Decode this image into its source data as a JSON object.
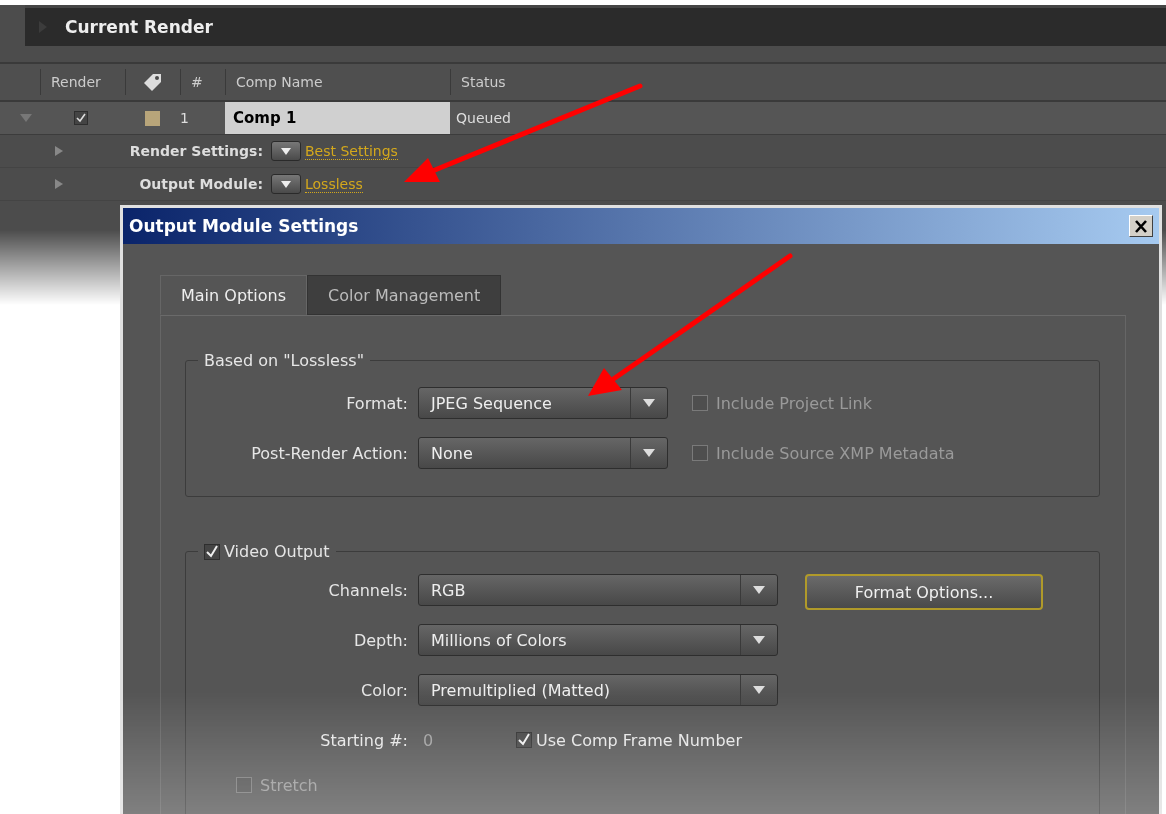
{
  "panel": {
    "title": "Current Render",
    "columns": [
      {
        "kind": "text",
        "label": "Render"
      },
      {
        "kind": "icon"
      },
      {
        "kind": "text",
        "label": "#"
      },
      {
        "kind": "text",
        "label": "Comp Name"
      },
      {
        "kind": "text",
        "label": "Status"
      }
    ],
    "rows": [
      {
        "expanded": true,
        "render": true,
        "color": "#b8a57a",
        "number": "1",
        "comp_name": "Comp 1",
        "status": "Queued",
        "settings": [
          {
            "label": "Render Settings:",
            "value": "Best Settings",
            "expanded": false
          },
          {
            "label": "Output Module:",
            "value": "Lossless",
            "expanded": false
          }
        ]
      }
    ]
  },
  "dialog": {
    "title": "Output Module Settings",
    "tabs": [
      {
        "label": "Main Options",
        "selected": true
      },
      {
        "label": "Color Management",
        "selected": false
      }
    ],
    "based_on": {
      "title": "Based on \"Lossless\"",
      "fields": [
        {
          "label": "Format:",
          "value": "JPEG Sequence"
        },
        {
          "label": "Post-Render Action:",
          "value": "None"
        }
      ],
      "options": [
        {
          "label": "Include Project Link",
          "checked": false,
          "disabled": true
        },
        {
          "label": "Include Source XMP Metadata",
          "checked": false,
          "disabled": true
        }
      ]
    },
    "video_output": {
      "label": "Video Output",
      "checked": true,
      "fields": [
        {
          "label": "Channels:",
          "value": "RGB"
        },
        {
          "label": "Depth:",
          "value": "Millions of Colors"
        },
        {
          "label": "Color:",
          "value": "Premultiplied (Matted)"
        }
      ],
      "format_options_button": "Format Options...",
      "starting": {
        "label": "Starting #:",
        "value": "0",
        "disabled": true
      },
      "use_comp_frame": {
        "label": "Use Comp Frame Number",
        "checked": true
      },
      "stretch": {
        "label": "Stretch",
        "checked": false,
        "disabled": true
      }
    }
  }
}
